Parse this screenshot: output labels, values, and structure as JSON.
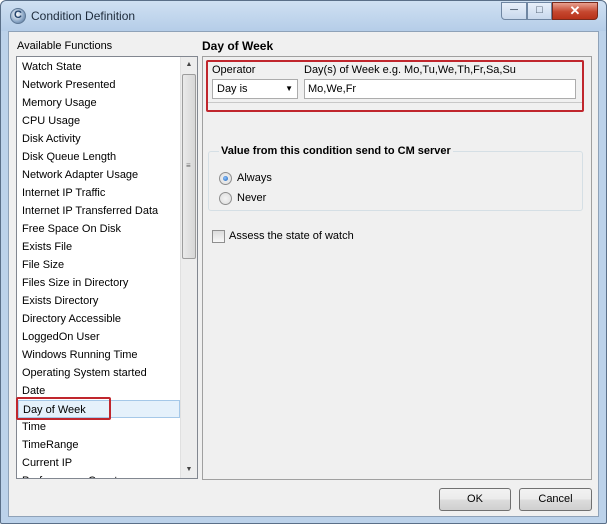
{
  "window": {
    "title": "Condition Definition",
    "minimize_glyph": "─",
    "maximize_glyph": "□",
    "close_glyph": "✕"
  },
  "left_panel": {
    "label": "Available Functions",
    "items": [
      "Watch State",
      "Network Presented",
      "Memory Usage",
      "CPU Usage",
      "Disk Activity",
      "Disk Queue Length",
      "Network Adapter Usage",
      "Internet IP Traffic",
      "Internet IP Transferred Data",
      "Free Space On Disk",
      "Exists File",
      "File Size",
      "Files Size in Directory",
      "Exists Directory",
      "Directory Accessible",
      "LoggedOn User",
      "Windows Running Time",
      "Operating System started",
      "Date",
      "Day of Week",
      "Time",
      "TimeRange",
      "Current IP",
      "Performance Counter"
    ],
    "selected_item": "Day of Week",
    "scroll_up_glyph": "▲",
    "scroll_down_glyph": "▼",
    "grip_glyph": "≡"
  },
  "right_panel": {
    "title": "Day of Week",
    "operator_label": "Operator",
    "operator_value": "Day is",
    "dropdown_glyph": "▼",
    "days_label": "Day(s) of Week e.g. Mo,Tu,We,Th,Fr,Sa,Su",
    "days_value": "Mo,We,Fr",
    "send_group_title": "Value from this condition send to CM server",
    "radio_always": "Always",
    "radio_never": "Never",
    "selected_radio": "Always",
    "assess_checkbox_label": "Assess the state of watch",
    "assess_checked": false
  },
  "buttons": {
    "ok": "OK",
    "cancel": "Cancel"
  },
  "colors": {
    "highlight": "#c0262d",
    "selection": "#e5f1fb",
    "titlebar": "#b5cde8"
  }
}
